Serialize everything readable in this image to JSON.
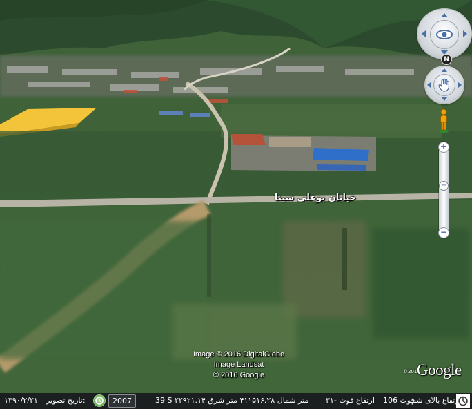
{
  "road_label": "خیابان بوعلی سینا",
  "attribution": {
    "lines": [
      "Image © 2016 DigitalGlobe",
      "Image Landsat",
      "© 2016 Google"
    ],
    "logo": "Google",
    "logo_copyright": "©2016"
  },
  "navigation": {
    "look_icon": "eye-icon",
    "move_icon": "hand-icon",
    "north_label": "N",
    "street_view_icon": "pegman-icon",
    "zoom_in": "+",
    "zoom_out": "−",
    "zoom_level": 0.45
  },
  "status_bar": {
    "date": "۱۳۹۰/۲/۲۱",
    "date_label": "تاریخ تصویر:",
    "history_icon": "clock-icon",
    "year": "2007",
    "coordinates": "39 S ۲۲۹۲۱.۱۴ متر شمال ۴۱۱۵۱۶.۲۸ متر شرق",
    "elevation": "۳۱- فوت",
    "elevation_label": "ارتفاع",
    "eye_alt_value": "106 فوت",
    "eye_alt_label": "ارتفاع بالای شم",
    "streaming_icon": "streaming-icon"
  },
  "colors": {
    "status_bg": "#1c1f20",
    "status_text": "#ffffff",
    "control_face": "#e9ecef",
    "control_accent": "#4a6fa5",
    "pegman": "#f0a20a"
  }
}
